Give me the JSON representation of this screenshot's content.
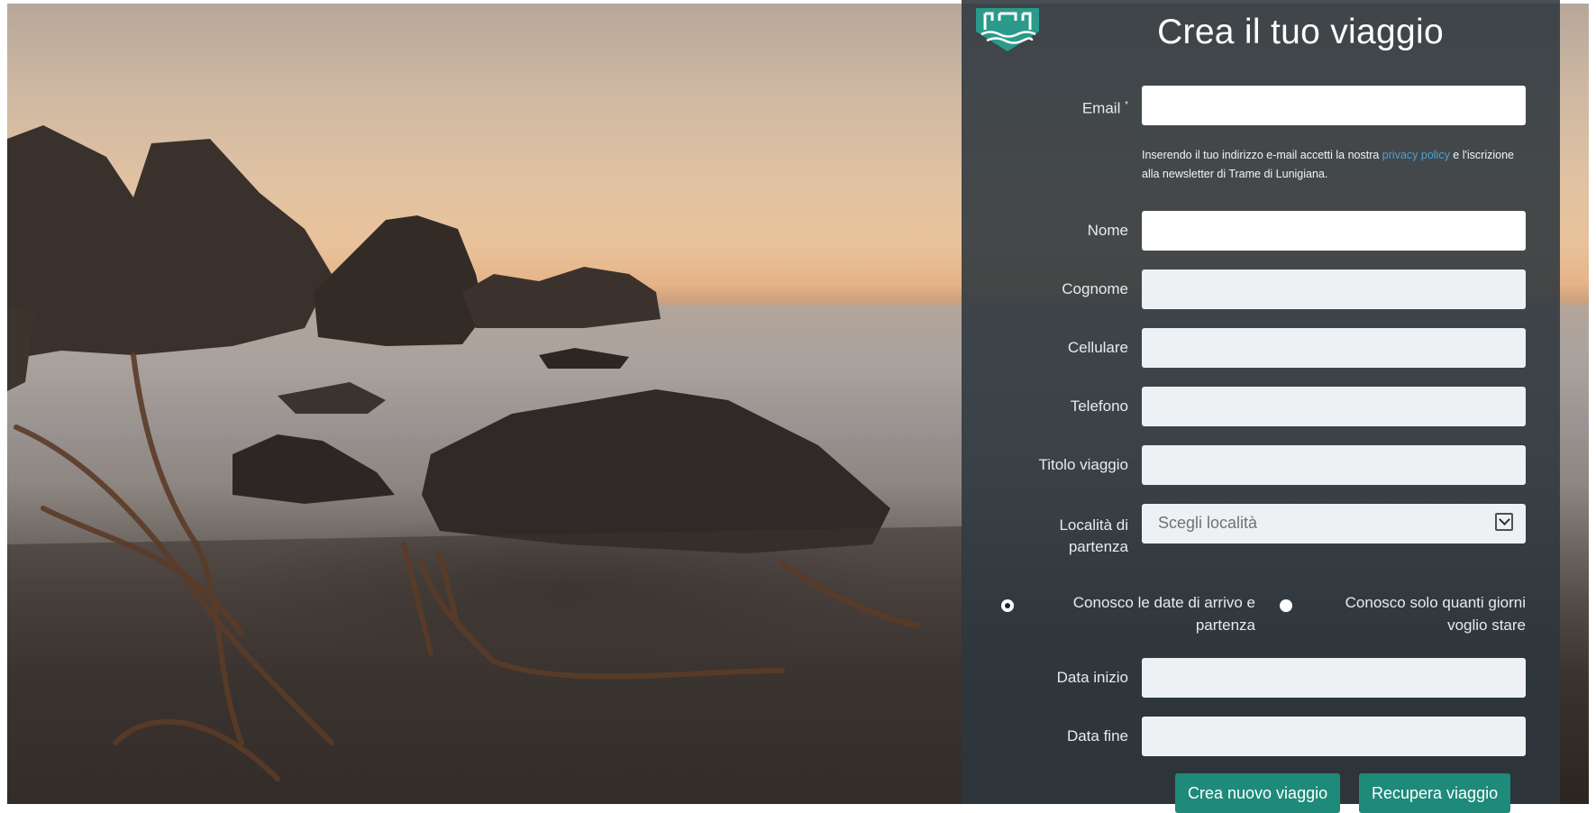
{
  "form": {
    "title": "Crea il tuo viaggio",
    "email_label": "Email",
    "email_required_mark": "*",
    "note_before_link": "Inserendo il tuo indirizzo e-mail accetti la nostra ",
    "note_link": "privacy policy",
    "note_after_link": " e l'iscrizione alla newsletter di Trame di Lunigiana.",
    "fields": {
      "nome": "Nome",
      "cognome": "Cognome",
      "cellulare": "Cellulare",
      "telefono": "Telefono",
      "titolo": "Titolo viaggio",
      "localita_line1": "Località di",
      "localita_line2": "partenza"
    },
    "select": {
      "value": "Scegli località"
    },
    "options": {
      "dates_line1": "Conosco le date di arrivo e",
      "dates_line2": "partenza",
      "days_line1": "Conosco solo quanti giorni",
      "days_line2": "voglio stare",
      "selected": "dates"
    },
    "data_inizio": "Data inizio",
    "data_fine": "Data fine",
    "buttons": {
      "create": "Crea nuovo viaggio",
      "recover": "Recupera viaggio"
    }
  },
  "colors": {
    "panel_bg": "#2e373e",
    "accent": "#1e8a7a",
    "link": "#4da0d6"
  },
  "icons": {
    "logo": "castle-waves-shield-icon",
    "select": "chevron-down-icon"
  }
}
